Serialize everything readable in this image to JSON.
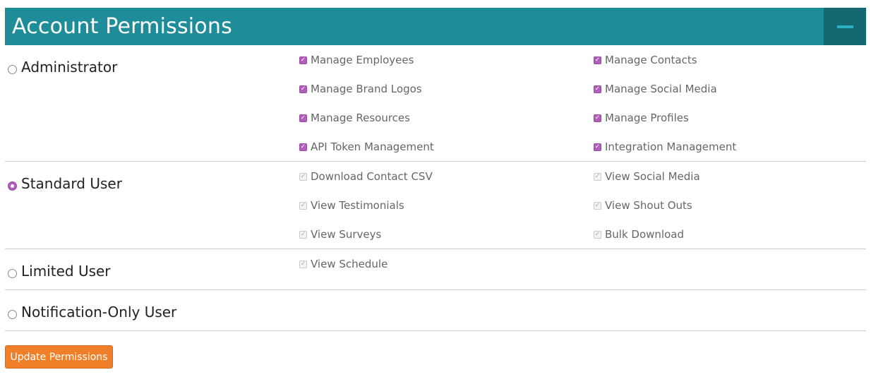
{
  "header": {
    "title": "Account Permissions",
    "collapse_icon": "minus-icon"
  },
  "roles": [
    {
      "label": "Administrator",
      "selected": false,
      "permissions": [
        [
          "Manage Employees",
          "Manage Contacts"
        ],
        [
          "Manage Brand Logos",
          "Manage Social Media"
        ],
        [
          "Manage Resources",
          "Manage Profiles"
        ],
        [
          "API Token Management",
          "Integration Management"
        ]
      ]
    },
    {
      "label": "Standard User",
      "selected": true,
      "permissions": [
        [
          "Download Contact CSV",
          "View Social Media"
        ],
        [
          "View Testimonials",
          "View Shout Outs"
        ],
        [
          "View Surveys",
          "Bulk Download"
        ]
      ]
    },
    {
      "label": "Limited User",
      "selected": false,
      "permissions": [
        [
          "View Schedule"
        ]
      ]
    },
    {
      "label": "Notification-Only User",
      "selected": false,
      "permissions": []
    }
  ],
  "checkbox_states": {
    "Administrator": "checked",
    "others": "checked-disabled"
  },
  "colors": {
    "header": "#1e8c99",
    "header_button": "#15686f",
    "accent": "#b15dbb",
    "button": "#f07f2a"
  },
  "update_button_label": "Update Permissions"
}
